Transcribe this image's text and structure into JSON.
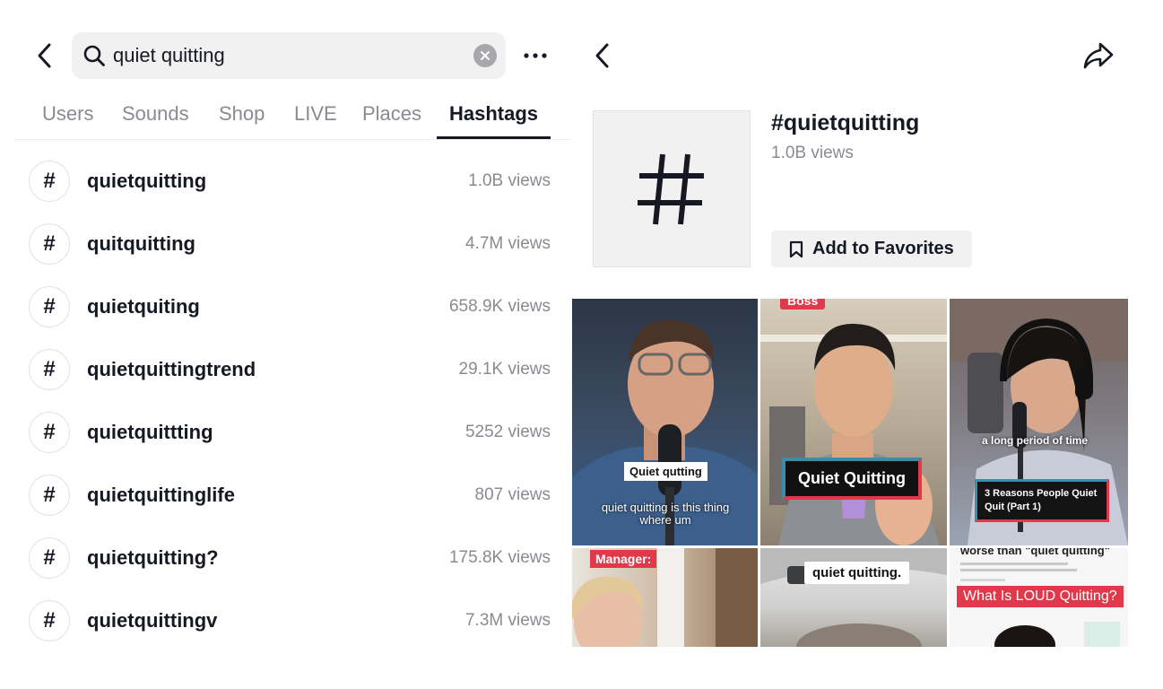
{
  "search": {
    "query": "quiet quitting"
  },
  "tabs": [
    {
      "label": "Users"
    },
    {
      "label": "Sounds"
    },
    {
      "label": "Shop"
    },
    {
      "label": "LIVE"
    },
    {
      "label": "Places"
    },
    {
      "label": "Hashtags",
      "active": true
    }
  ],
  "hashtags": [
    {
      "badge": "#",
      "name": "quietquitting",
      "views": "1.0B views"
    },
    {
      "badge": "#",
      "name": "quitquitting",
      "views": "4.7M views"
    },
    {
      "badge": "#",
      "name": "quietquiting",
      "views": "658.9K views"
    },
    {
      "badge": "#",
      "name": "quietquittingtrend",
      "views": "29.1K views"
    },
    {
      "badge": "#",
      "name": "quietquittting",
      "views": "5252 views"
    },
    {
      "badge": "#",
      "name": "quietquittinglife",
      "views": "807 views"
    },
    {
      "badge": "#",
      "name": "quietquitting?",
      "views": "175.8K views"
    },
    {
      "badge": "#",
      "name": "quietquittingv",
      "views": "7.3M views"
    }
  ],
  "detail": {
    "title": "#quietquitting",
    "views": "1.0B views",
    "favorite_label": "Add to Favorites"
  },
  "videos": [
    {
      "caption": "Quiet qutting",
      "subtitle": "quiet quitting is this thing where um"
    },
    {
      "tag": "Boss",
      "caption": "Quiet Quitting"
    },
    {
      "overlay": "a long period of time",
      "caption": "3 Reasons People Quiet Quit (Part 1)"
    },
    {
      "tag": "Manager:"
    },
    {
      "caption": "quiet quitting."
    },
    {
      "headline": "worse than \"quiet quitting\"",
      "caption": "What Is LOUD Quitting?"
    }
  ],
  "icons": {
    "back": "chevron-left-icon",
    "search": "search-icon",
    "clear": "clear-icon",
    "more": "more-icon",
    "share": "share-icon",
    "bookmark": "bookmark-icon",
    "hashtag": "hashtag-icon"
  },
  "colors": {
    "text": "#161823",
    "muted": "#8a8b91",
    "input_bg": "#f1f1f2",
    "tag_red": "#e0394c",
    "caption_frame": "#3a8fa8"
  }
}
